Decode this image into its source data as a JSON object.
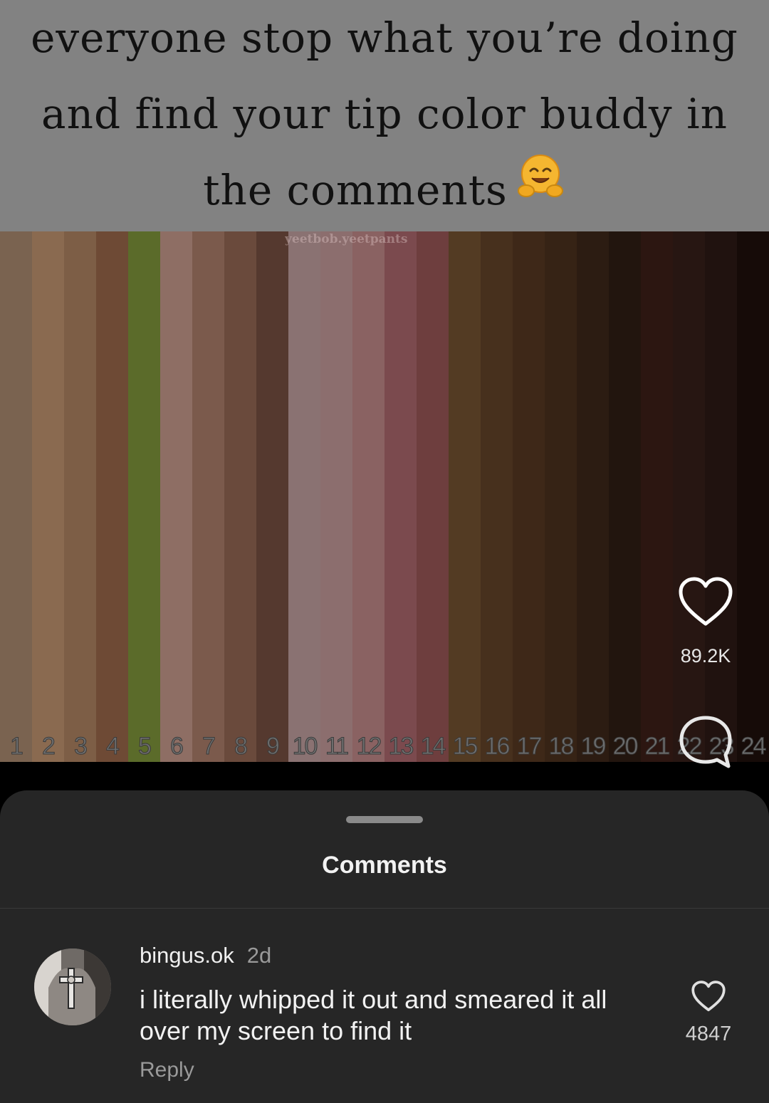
{
  "post": {
    "caption": "everyone stop what you’re doing and find your tip color buddy in the comments",
    "caption_emoji": "hugging-face-emoji",
    "watermark": "yeetbob.yeetpants",
    "swatches": [
      {
        "label": "1",
        "color": "#7a6350"
      },
      {
        "label": "2",
        "color": "#8a6a50"
      },
      {
        "label": "3",
        "color": "#7d5e46"
      },
      {
        "label": "4",
        "color": "#6e4a35"
      },
      {
        "label": "5",
        "color": "#5b6b2a"
      },
      {
        "label": "6",
        "color": "#8e6e64"
      },
      {
        "label": "7",
        "color": "#7b5a4c"
      },
      {
        "label": "8",
        "color": "#6a4a3c"
      },
      {
        "label": "9",
        "color": "#55392f"
      },
      {
        "label": "10",
        "color": "#8a7272"
      },
      {
        "label": "11",
        "color": "#8c6e6e"
      },
      {
        "label": "12",
        "color": "#8a6262"
      },
      {
        "label": "13",
        "color": "#7b4a4e"
      },
      {
        "label": "14",
        "color": "#6e3e3e"
      },
      {
        "label": "15",
        "color": "#533b23"
      },
      {
        "label": "16",
        "color": "#47301d"
      },
      {
        "label": "17",
        "color": "#3e2818"
      },
      {
        "label": "18",
        "color": "#362315"
      },
      {
        "label": "19",
        "color": "#2c1c12"
      },
      {
        "label": "20",
        "color": "#22150e"
      },
      {
        "label": "21",
        "color": "#2c1611"
      },
      {
        "label": "22",
        "color": "#271612"
      },
      {
        "label": "23",
        "color": "#20120f"
      },
      {
        "label": "24",
        "color": "#160b08"
      }
    ]
  },
  "actions": {
    "like_count": "89.2K",
    "like_icon": "heart-icon",
    "comment_icon": "comment-bubble-icon"
  },
  "sheet": {
    "title": "Comments"
  },
  "comments": [
    {
      "username": "bingus.ok",
      "time": "2d",
      "text": "i literally whipped it out and smeared it all over my screen to find it",
      "reply_label": "Reply",
      "likes": "4847"
    }
  ]
}
